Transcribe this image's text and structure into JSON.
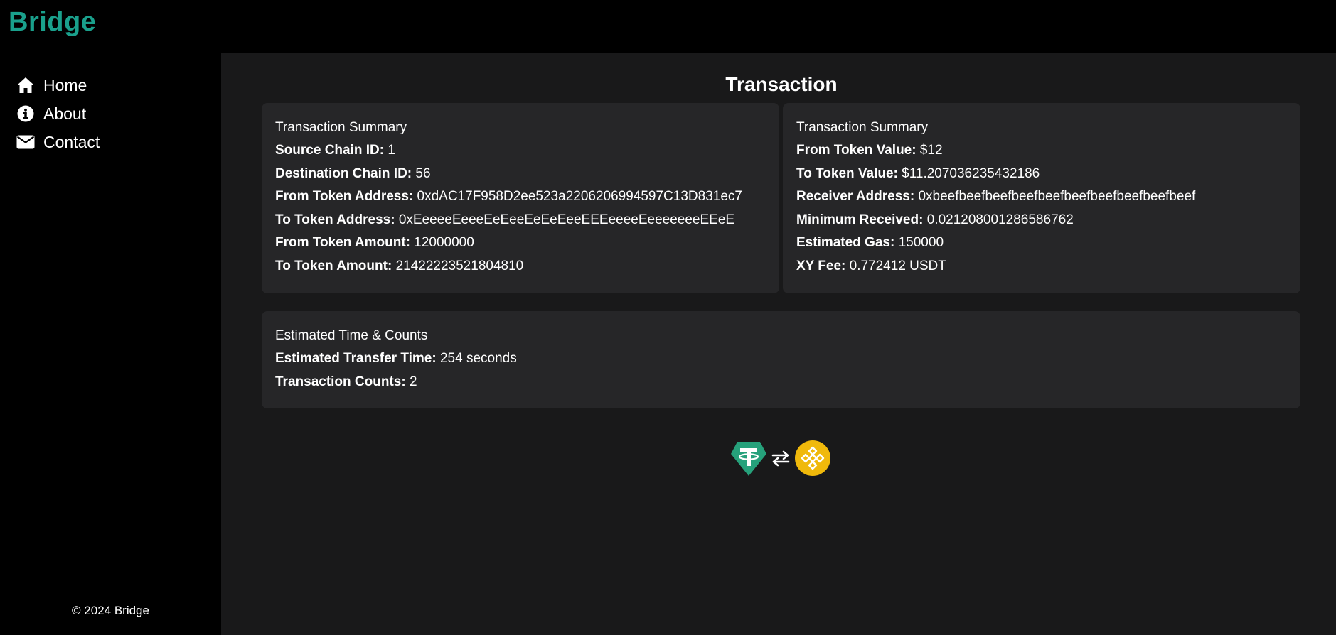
{
  "app": {
    "brand": "Bridge"
  },
  "sidebar": {
    "items": [
      {
        "label": "Home",
        "icon": "home-icon"
      },
      {
        "label": "About",
        "icon": "info-icon"
      },
      {
        "label": "Contact",
        "icon": "envelope-icon"
      }
    ],
    "footer": "© 2024 Bridge"
  },
  "main": {
    "title": "Transaction",
    "left_card": {
      "heading": "Transaction Summary",
      "rows": [
        {
          "label": "Source Chain ID:",
          "value": "1"
        },
        {
          "label": "Destination Chain ID:",
          "value": "56"
        },
        {
          "label": "From Token Address:",
          "value": "0xdAC17F958D2ee523a2206206994597C13D831ec7"
        },
        {
          "label": "To Token Address:",
          "value": "0xEeeeeEeeeEeEeeEeEeEeeEEEeeeeEeeeeeeeEEeE"
        },
        {
          "label": "From Token Amount:",
          "value": "12000000"
        },
        {
          "label": "To Token Amount:",
          "value": "21422223521804810"
        }
      ]
    },
    "right_card": {
      "heading": "Transaction Summary",
      "rows": [
        {
          "label": "From Token Value:",
          "value": "$12"
        },
        {
          "label": "To Token Value:",
          "value": "$11.207036235432186"
        },
        {
          "label": "Receiver Address:",
          "value": "0xbeefbeefbeefbeefbeefbeefbeefbeefbeefbeef"
        },
        {
          "label": "Minimum Received:",
          "value": "0.021208001286586762"
        },
        {
          "label": "Estimated Gas:",
          "value": "150000"
        },
        {
          "label": "XY Fee:",
          "value": "0.772412 USDT"
        }
      ]
    },
    "bottom_card": {
      "heading": "Estimated Time & Counts",
      "rows": [
        {
          "label": "Estimated Transfer Time:",
          "value": "254 seconds"
        },
        {
          "label": "Transaction Counts:",
          "value": "2"
        }
      ]
    },
    "token_icons": {
      "from": "tether-usdt-icon",
      "swap": "swap-arrows-icon",
      "to": "bnb-icon"
    }
  },
  "colors": {
    "brand": "#1aa08c",
    "background": "#000000",
    "main_bg": "#19191a",
    "card_bg": "#262628",
    "tether": "#26a17b",
    "bnb": "#f0b90b"
  }
}
